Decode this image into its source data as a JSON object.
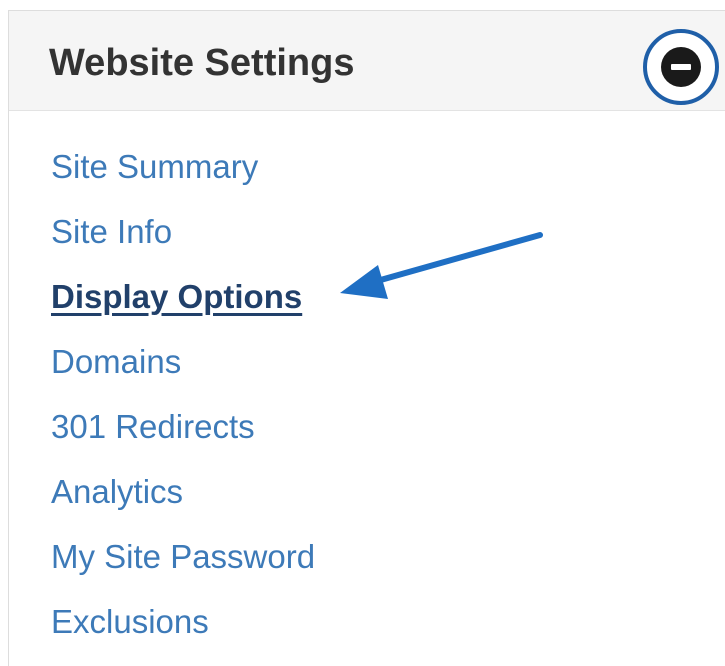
{
  "panel": {
    "title": "Website Settings",
    "collapse_icon": "minus-circle-icon"
  },
  "nav": {
    "items": [
      {
        "label": "Site Summary",
        "active": false
      },
      {
        "label": "Site Info",
        "active": false
      },
      {
        "label": "Display Options",
        "active": true
      },
      {
        "label": "Domains",
        "active": false
      },
      {
        "label": "301 Redirects",
        "active": false
      },
      {
        "label": "Analytics",
        "active": false
      },
      {
        "label": "My Site Password",
        "active": false
      },
      {
        "label": "Exclusions",
        "active": false
      }
    ]
  },
  "annotation": {
    "arrow_icon": "arrow-left-icon",
    "color": "#1f6fc4"
  },
  "colors": {
    "link": "#3d7ab8",
    "active_link": "#21406a",
    "header_bg": "#f5f5f5",
    "highlight_ring": "#1f5fa8"
  }
}
